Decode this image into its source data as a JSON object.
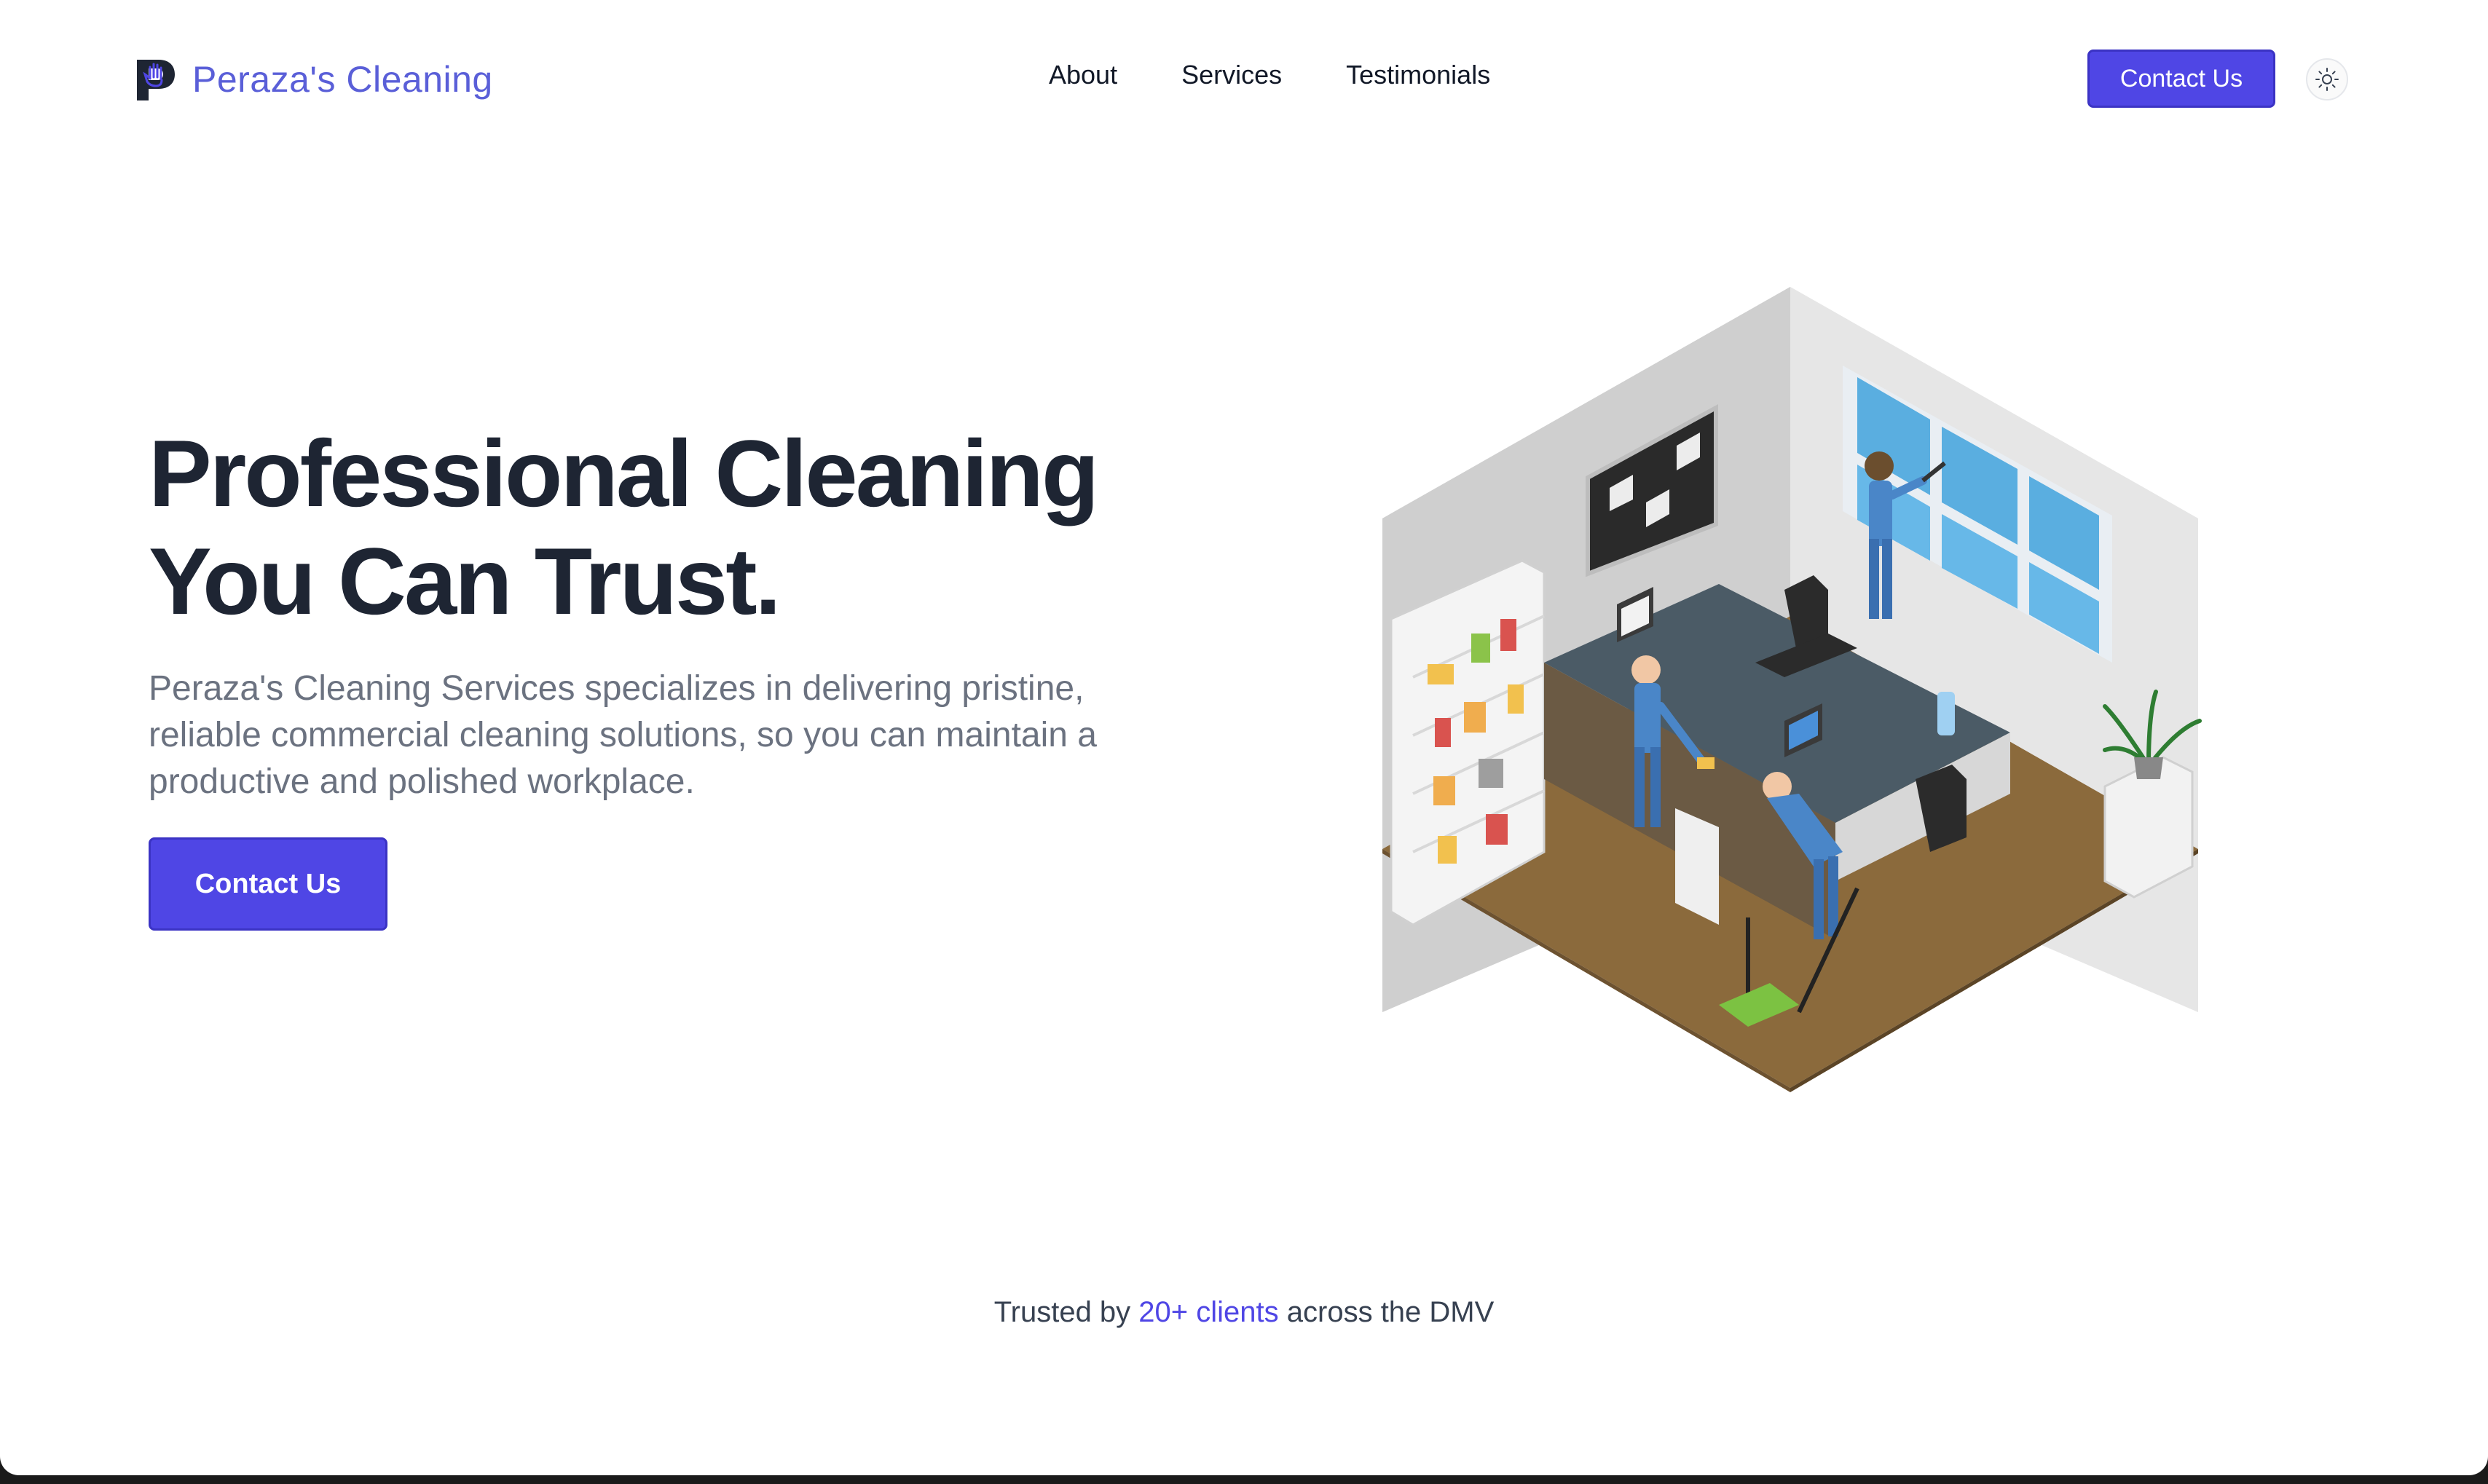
{
  "brand": {
    "name": "Peraza's Cleaning",
    "logo_icon": "p-hand-logo-icon"
  },
  "nav": {
    "links": [
      {
        "label": "About"
      },
      {
        "label": "Services"
      },
      {
        "label": "Testimonials"
      }
    ],
    "cta_label": "Contact Us",
    "theme_icon": "sun-icon"
  },
  "hero": {
    "title_line1": "Professional Cleaning",
    "title_line2": "You Can Trust.",
    "description": "Peraza's Cleaning Services specializes in delivering pristine, reliable commercial cleaning solutions, so you can maintain a productive and polished workplace.",
    "cta_label": "Contact Us",
    "illustration": "isometric-office-cleaning-illustration"
  },
  "trusted": {
    "prefix": "Trusted by",
    "highlight": "20+ clients",
    "suffix": "across the DMV"
  },
  "colors": {
    "accent": "#4f46e5",
    "brand_text": "#5a5fd8",
    "heading": "#1e2533",
    "body_text": "#6b7280"
  }
}
